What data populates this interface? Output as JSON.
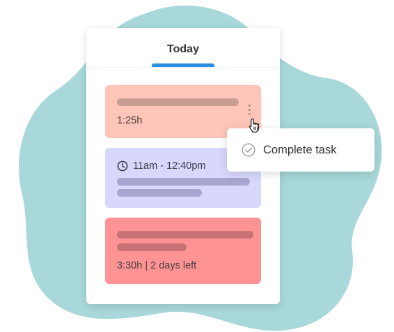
{
  "colors": {
    "blob": "#a8d8d9",
    "tab_indicator": "#2d8ee0",
    "card_1_bg": "#fec5b8",
    "card_1_bar": "#c79d94",
    "card_2_bg": "#d8d8fd",
    "card_2_bar": "#a6a6d0",
    "card_3_bg": "#fe9396",
    "card_3_bar": "#c97275",
    "check_icon": "#9b9b9b"
  },
  "tabs": [
    {
      "label": "Today",
      "active": true
    }
  ],
  "tasks": [
    {
      "meta": "1:25h",
      "has_menu": true
    },
    {
      "time": "11am - 12:40pm",
      "icon": "clock-icon"
    },
    {
      "meta": "3:30h | 2 days left"
    }
  ],
  "context_menu": {
    "items": [
      {
        "label": "Complete task",
        "icon": "check-circle-icon"
      }
    ]
  }
}
